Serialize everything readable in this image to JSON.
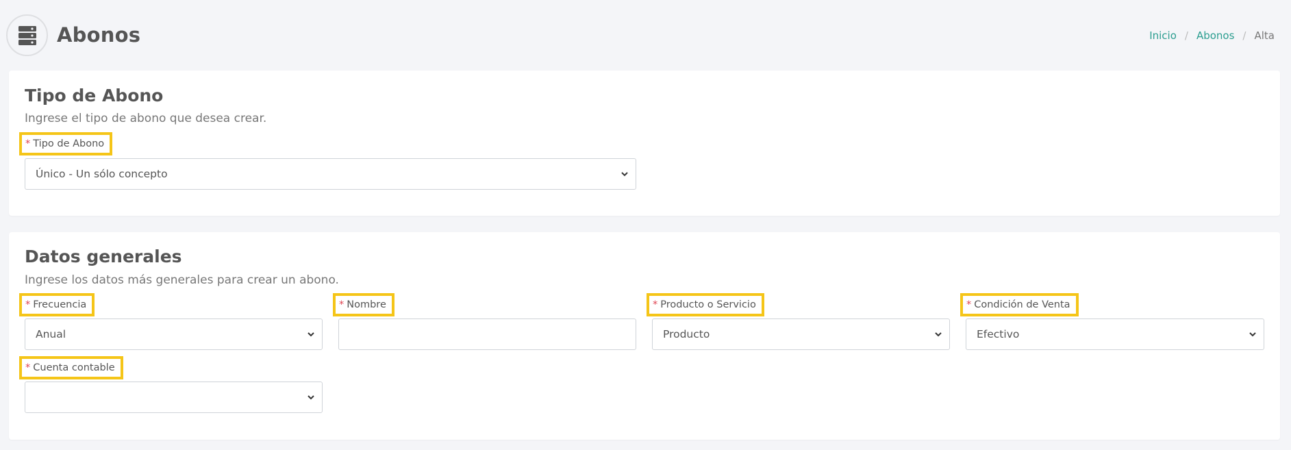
{
  "header": {
    "title": "Abonos",
    "icon": "server-stack-icon",
    "breadcrumb": [
      {
        "label": "Inicio",
        "link": true
      },
      {
        "label": "Abonos",
        "link": true
      },
      {
        "label": "Alta",
        "link": false
      }
    ]
  },
  "tipo_card": {
    "title": "Tipo de Abono",
    "subtitle": "Ingrese el tipo de abono que desea crear.",
    "tipo_field": {
      "label": "Tipo de Abono",
      "value": "Único - Un sólo concepto"
    }
  },
  "datos_card": {
    "title": "Datos generales",
    "subtitle": "Ingrese los datos más generales para crear un abono.",
    "frecuencia": {
      "label": "Frecuencia",
      "value": "Anual"
    },
    "nombre": {
      "label": "Nombre",
      "value": "",
      "placeholder": ""
    },
    "producto": {
      "label": "Producto o Servicio",
      "value": "Producto"
    },
    "condicion": {
      "label": "Condición de Venta",
      "value": "Efectivo"
    },
    "cuenta": {
      "label": "Cuenta contable",
      "value": ""
    }
  },
  "required_marker": "*",
  "colors": {
    "accent": "#2a9d8f",
    "highlight": "#f5c518",
    "required": "#e0424f"
  }
}
